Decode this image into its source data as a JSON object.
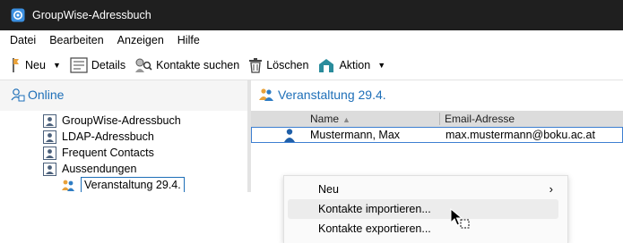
{
  "window": {
    "title": "GroupWise-Adressbuch"
  },
  "menubar": {
    "items": [
      "Datei",
      "Bearbeiten",
      "Anzeigen",
      "Hilfe"
    ]
  },
  "toolbar": {
    "new_label": "Neu",
    "details_label": "Details",
    "search_label": "Kontakte suchen",
    "delete_label": "Löschen",
    "action_label": "Aktion"
  },
  "left_pane": {
    "header": "Online",
    "tree": [
      {
        "label": "GroupWise-Adressbuch"
      },
      {
        "label": "LDAP-Adressbuch"
      },
      {
        "label": "Frequent Contacts"
      },
      {
        "label": "Aussendungen"
      },
      {
        "label": "Veranstaltung 29.4.",
        "selected": true
      }
    ]
  },
  "right_pane": {
    "header": "Veranstaltung 29.4.",
    "columns": {
      "name": "Name",
      "email": "Email-Adresse"
    },
    "rows": [
      {
        "name": "Mustermann, Max",
        "email": "max.mustermann@boku.ac.at"
      }
    ]
  },
  "context_menu": {
    "items": [
      {
        "label": "Neu",
        "submenu": true
      },
      {
        "label": "Kontakte importieren...",
        "hover": true
      },
      {
        "label": "Kontakte exportieren..."
      }
    ]
  },
  "colors": {
    "titlebar_bg": "#1f1f1f",
    "accent": "#1e6fb8",
    "selection_border": "#3d7fd1",
    "column_header_bg": "#dcdcdc"
  },
  "icons": [
    "groupwise-app-icon",
    "pin-icon",
    "details-icon",
    "search-contacts-icon",
    "trash-icon",
    "action-icon",
    "online-icon",
    "address-book-icon",
    "group-icon",
    "person-icon",
    "cursor-icon"
  ]
}
